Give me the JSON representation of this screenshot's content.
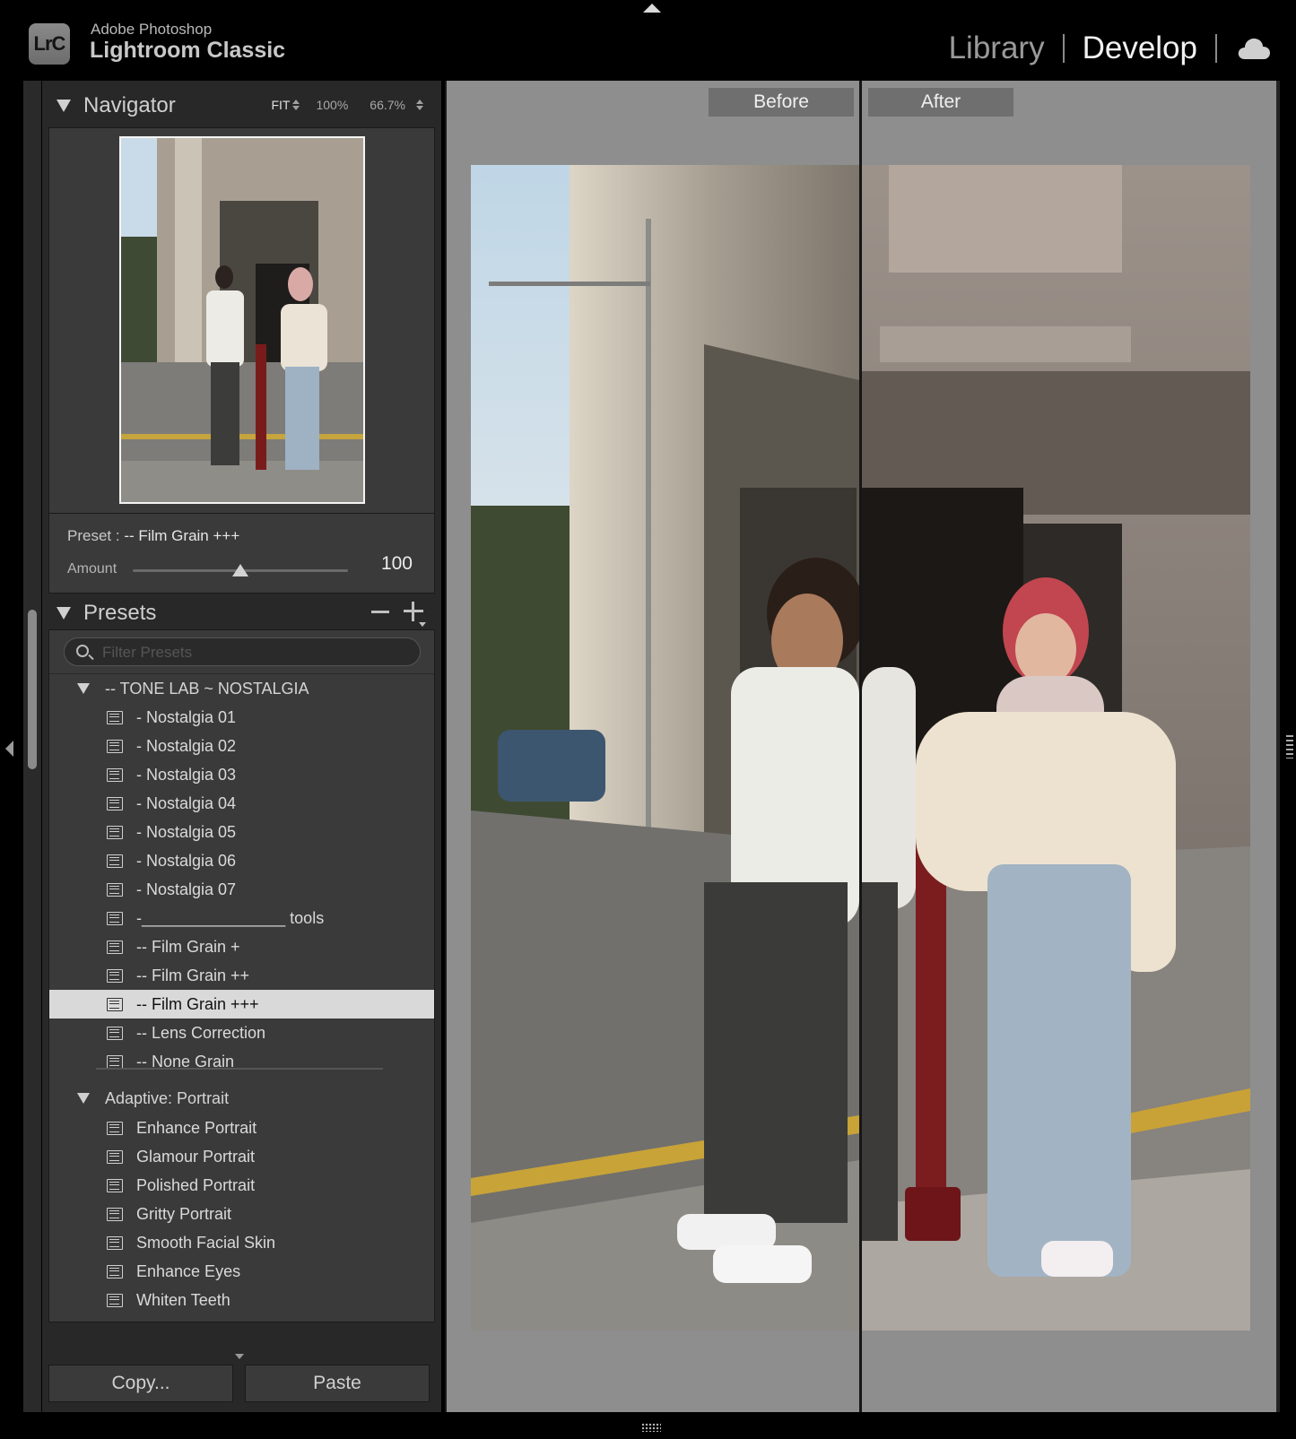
{
  "app": {
    "logo_text": "LrC",
    "brand_line1": "Adobe Photoshop",
    "brand_line2": "Lightroom Classic"
  },
  "modules": {
    "library": "Library",
    "develop": "Develop",
    "active": "Develop",
    "cloud_icon": "cloud-icon"
  },
  "navigator": {
    "title": "Navigator",
    "zoom_fit": "FIT",
    "zoom_100": "100%",
    "zoom_custom": "66.7%"
  },
  "preset_amount": {
    "prefix": "Preset : ",
    "preset_name": "-- Film Grain +++",
    "amount_label": "Amount",
    "amount_value": "100",
    "amount_fraction": 0.5
  },
  "presets": {
    "title": "Presets",
    "filter_placeholder": "Filter Presets",
    "groups": [
      {
        "label": "-- TONE LAB ~ NOSTALGIA",
        "items": [
          "- Nostalgia 01",
          "- Nostalgia 02",
          "- Nostalgia 03",
          "- Nostalgia 04",
          "- Nostalgia 05",
          "- Nostalgia 06",
          "- Nostalgia 07",
          "-________________ tools",
          "-- Film Grain +",
          "-- Film Grain ++",
          "-- Film Grain +++",
          "-- Lens Correction",
          "-- None Grain"
        ],
        "selected_index": 10
      },
      {
        "label": "Adaptive: Portrait",
        "items": [
          "Enhance Portrait",
          "Glamour Portrait",
          "Polished Portrait",
          "Gritty Portrait",
          "Smooth Facial Skin",
          "Enhance Eyes",
          "Whiten Teeth"
        ]
      }
    ]
  },
  "buttons": {
    "copy": "Copy...",
    "paste": "Paste"
  },
  "compare": {
    "before": "Before",
    "after": "After"
  }
}
